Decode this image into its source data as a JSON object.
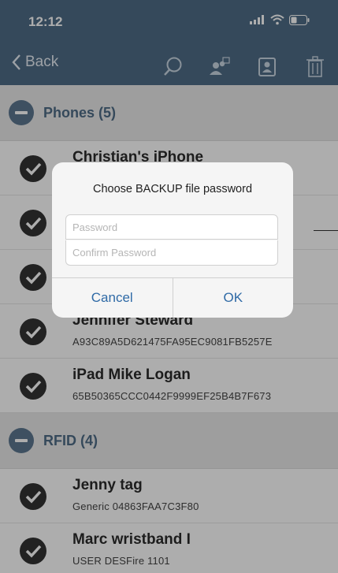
{
  "status_bar": {
    "time": "12:12"
  },
  "nav": {
    "back_label": "Back",
    "icons": [
      "search-icon",
      "contacts-icon",
      "contact-card-icon",
      "trash-icon"
    ]
  },
  "sections": [
    {
      "title": "Phones (5)",
      "rows": [
        {
          "title": "Christian's iPhone",
          "subtitle": ""
        },
        {
          "title": "",
          "subtitle": ""
        },
        {
          "title": "",
          "subtitle": ""
        },
        {
          "title": "Jennifer Steward",
          "subtitle": "A93C89A5D621475FA95EC9081FB5257E"
        },
        {
          "title": "iPad Mike Logan",
          "subtitle": "65B50365CCC0442F9999EF25B4B7F673"
        }
      ]
    },
    {
      "title": "RFID (4)",
      "rows": [
        {
          "title": "Jenny tag",
          "subtitle": "Generic 04863FAA7C3F80"
        },
        {
          "title": "Marc wristband I",
          "subtitle": "USER DESFire 1101"
        }
      ]
    }
  ],
  "dialog": {
    "title": "Choose BACKUP file password",
    "password_placeholder": "Password",
    "confirm_placeholder": "Confirm Password",
    "cancel_label": "Cancel",
    "ok_label": "OK"
  },
  "colors": {
    "nav_bar": "#4f6c86",
    "section_icon": "#5c7790",
    "button_text": "#2f6aa6"
  }
}
